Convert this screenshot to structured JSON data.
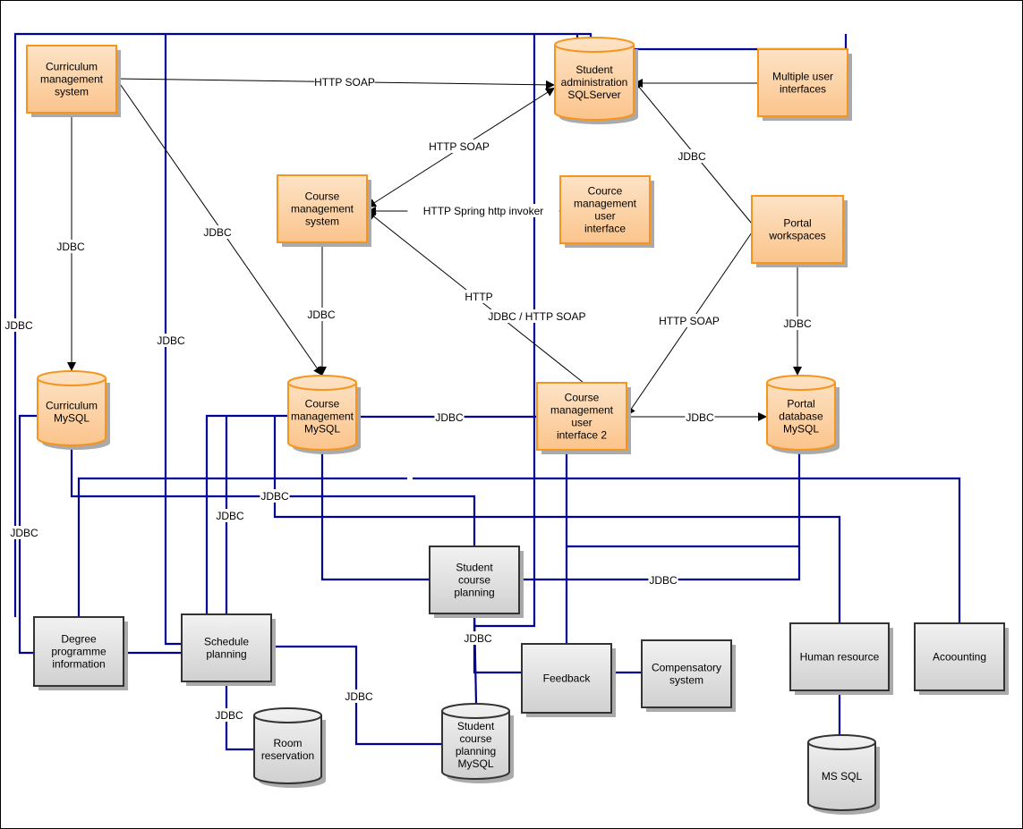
{
  "colors": {
    "system_fill_top": "#fde3c6",
    "system_fill_bottom": "#fbc48c",
    "system_stroke": "#f5941e",
    "external_fill_top": "#f2f2f2",
    "external_fill_bottom": "#d0d0d0",
    "external_stroke": "#333333",
    "integration_line": "#000099",
    "dependency_line": "#000000"
  },
  "nodes": {
    "curriculum_mgmt": {
      "label": "Curriculum management system",
      "kind": "system"
    },
    "student_admin": {
      "label": "Student administration SQLServer",
      "kind": "system-db"
    },
    "multiple_ui": {
      "label": "Multiple user interfaces",
      "kind": "system"
    },
    "course_mgmt": {
      "label": "Course management system",
      "kind": "system"
    },
    "course_mgmt_ui": {
      "label": "Cource management user interface",
      "kind": "system"
    },
    "portal_ws": {
      "label": "Portal workspaces",
      "kind": "system"
    },
    "curriculum_mysql": {
      "label": "Curriculum MySQL",
      "kind": "system-db"
    },
    "course_mgmt_mysql": {
      "label": "Course management MySQL",
      "kind": "system-db"
    },
    "course_mgmt_ui2": {
      "label": "Course management user interface 2",
      "kind": "system"
    },
    "portal_db": {
      "label": "Portal database MySQL",
      "kind": "system-db"
    },
    "student_course_planning": {
      "label": "Student course planning",
      "kind": "external"
    },
    "degree_info": {
      "label": "Degree programme information",
      "kind": "external"
    },
    "schedule_planning": {
      "label": "Schedule planning",
      "kind": "external"
    },
    "feedback": {
      "label": "Feedback",
      "kind": "external"
    },
    "compensatory": {
      "label": "Compensatory system",
      "kind": "external"
    },
    "human_resource": {
      "label": "Human resource",
      "kind": "external"
    },
    "accounting": {
      "label": "Acoounting",
      "kind": "external"
    },
    "room_reservation": {
      "label": "Room reservation",
      "kind": "external-db"
    },
    "scp_mysql": {
      "label": "Student course planning MySQL",
      "kind": "external-db"
    },
    "ms_sql": {
      "label": "MS SQL",
      "kind": "external-db"
    }
  },
  "edge_labels": {
    "curr_to_sa": "HTTP SOAP",
    "cms_sa": "HTTP SOAP",
    "portal_sa": "JDBC",
    "cmui_cms": "HTTP Spring http invoker",
    "curr_currdb": "JDBC",
    "curr_cmdb": "JDBC",
    "cms_cmdb": "JDBC",
    "ui2_cms_http": "HTTP",
    "ui2_cms_jdbc": "JDBC / HTTP SOAP",
    "portal_ui2": "HTTP SOAP",
    "portal_pdb": "JDBC",
    "ui2_pdb": "JDBC",
    "left_outer": "JDBC",
    "sched_top": "JDBC",
    "currdb_degree": "JDBC",
    "cmdb_sched": "JDBC",
    "currdb_scp": "JDBC",
    "cmdb_ui2": "JDBC",
    "scp_pdb": "JDBC",
    "scp_db": "JDBC",
    "sched_scpdb": "JDBC",
    "sched_room": "JDBC"
  }
}
